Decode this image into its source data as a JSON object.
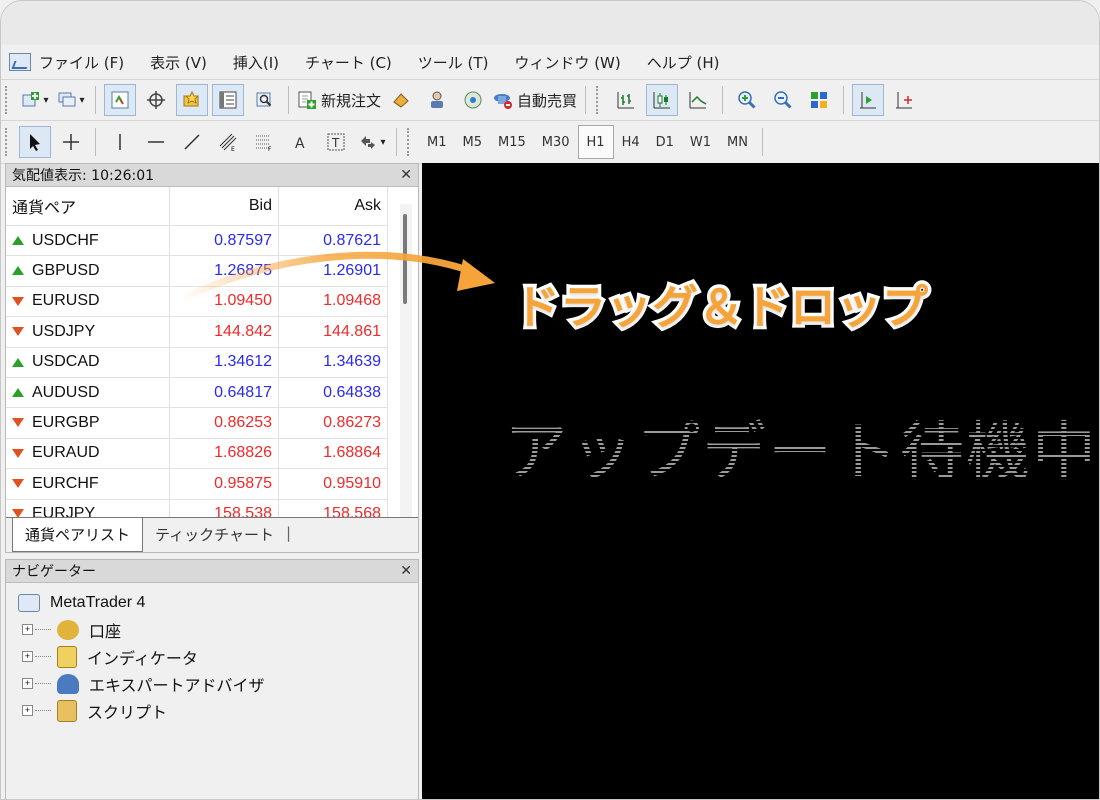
{
  "menu": [
    "ファイル (F)",
    "表示 (V)",
    "挿入(I)",
    "チャート (C)",
    "ツール (T)",
    "ウィンドウ (W)",
    "ヘルプ (H)"
  ],
  "toolbar1": {
    "new_order_label": "新規注文",
    "autotrade_label": "自動売買"
  },
  "timeframes": [
    "M1",
    "M5",
    "M15",
    "M30",
    "H1",
    "H4",
    "D1",
    "W1",
    "MN"
  ],
  "timeframe_active": "H1",
  "market_watch": {
    "title": "気配値表示: 10:26:01",
    "col_symbol": "通貨ペア",
    "col_bid": "Bid",
    "col_ask": "Ask",
    "rows": [
      {
        "symbol": "USDCHF",
        "bid": "0.87597",
        "ask": "0.87621",
        "dir": "up"
      },
      {
        "symbol": "GBPUSD",
        "bid": "1.26875",
        "ask": "1.26901",
        "dir": "up"
      },
      {
        "symbol": "EURUSD",
        "bid": "1.09450",
        "ask": "1.09468",
        "dir": "down"
      },
      {
        "symbol": "USDJPY",
        "bid": "144.842",
        "ask": "144.861",
        "dir": "down"
      },
      {
        "symbol": "USDCAD",
        "bid": "1.34612",
        "ask": "1.34639",
        "dir": "up"
      },
      {
        "symbol": "AUDUSD",
        "bid": "0.64817",
        "ask": "0.64838",
        "dir": "up"
      },
      {
        "symbol": "EURGBP",
        "bid": "0.86253",
        "ask": "0.86273",
        "dir": "down"
      },
      {
        "symbol": "EURAUD",
        "bid": "1.68826",
        "ask": "1.68864",
        "dir": "down"
      },
      {
        "symbol": "EURCHF",
        "bid": "0.95875",
        "ask": "0.95910",
        "dir": "down"
      },
      {
        "symbol": "EURJPY",
        "bid": "158.538",
        "ask": "158.568",
        "dir": "down"
      }
    ],
    "tabs": [
      "通貨ペアリスト",
      "ティックチャート"
    ]
  },
  "navigator": {
    "title": "ナビゲーター",
    "root": "MetaTrader 4",
    "items": [
      "口座",
      "インディケータ",
      "エキスパートアドバイザ",
      "スクリプト"
    ]
  },
  "chart": {
    "waiting_text": "アップデート待機中",
    "overlay_text": "ドラッグ＆ドロップ"
  },
  "colors": {
    "up": "#2aa02a",
    "down": "#e0521f",
    "bid_up": "#2a2af0",
    "bid_down": "#f02a2a",
    "overlay": "#f6a43a"
  },
  "icons": [
    "new-chart-icon",
    "profiles-icon",
    "market-watch-icon",
    "data-window-icon",
    "navigator-icon",
    "terminal-icon",
    "strategy-tester-icon",
    "new-order-icon",
    "metaeditor-icon",
    "signals-icon",
    "autotrading-icon",
    "bar-chart-icon",
    "candlestick-icon",
    "line-chart-icon",
    "zoom-in-icon",
    "zoom-out-icon",
    "tile-windows-icon",
    "chart-shift-icon",
    "autoscroll-icon",
    "cursor-icon",
    "crosshair-icon",
    "vertical-line-icon",
    "horizontal-line-icon",
    "trendline-icon",
    "equidistant-channel-icon",
    "fibonacci-icon",
    "text-icon",
    "text-label-icon",
    "arrows-icon"
  ]
}
